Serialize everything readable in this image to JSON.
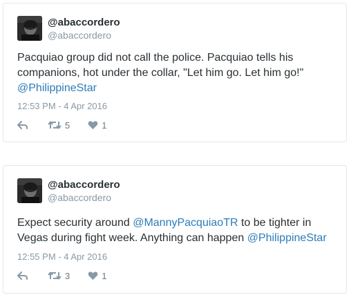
{
  "tweets": [
    {
      "display_name": "@abaccordero",
      "handle": "@abaccordero",
      "text_before": "Pacquiao group did not call the police. Pacquiao tells his companions, hot under the collar, \"Let him go. Let him go!\" ",
      "mention_1": "@PhilippineStar",
      "text_mid": "",
      "mention_2": "",
      "timestamp": "12:53 PM - 4 Apr 2016",
      "retweets": "5",
      "likes": "1"
    },
    {
      "display_name": "@abaccordero",
      "handle": "@abaccordero",
      "text_before": "Expect security around ",
      "mention_1": "@MannyPacquiaoTR",
      "text_mid": " to be tighter in Vegas during fight week. Anything can happen ",
      "mention_2": "@PhilippineStar",
      "timestamp": "12:55 PM - 4 Apr 2016",
      "retweets": "3",
      "likes": "1"
    }
  ],
  "icons": {
    "reply": "reply-icon",
    "retweet": "retweet-icon",
    "like": "heart-icon"
  },
  "colors": {
    "link": "#2b7bb9",
    "muted": "#8899a6",
    "border": "#e1e8ed",
    "text": "#292f33"
  }
}
